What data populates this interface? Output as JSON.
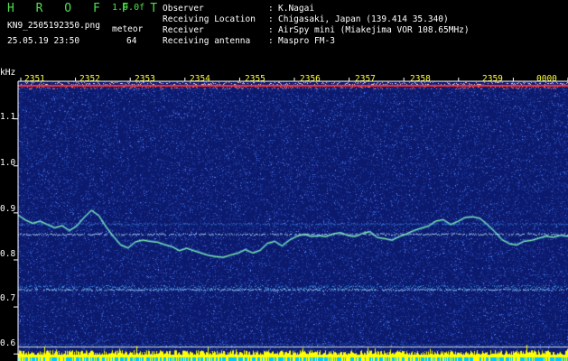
{
  "header": {
    "app_title": "H R O F F T",
    "version": "1.0.0f",
    "filename": "KN9_2505192350.png",
    "datetime": "25.05.19 23:50",
    "meteor_label": "meteor",
    "meteor_count": "64"
  },
  "info": [
    {
      "label": "Observer",
      "value": "K.Nagai"
    },
    {
      "label": "Receiving Location",
      "value": "Chigasaki, Japan (139.414 35.340)"
    },
    {
      "label": "Receiver",
      "value": "AirSpy mini (Miakejima VOR 108.65MHz)"
    },
    {
      "label": "Receiving antenna",
      "value": "Maspro FM-3"
    }
  ],
  "axes": {
    "y_unit": "kHz",
    "y_ticks": [
      {
        "label": "1.1",
        "value": 1.1
      },
      {
        "label": "1.0",
        "value": 1.0
      },
      {
        "label": "0.9",
        "value": 0.9
      },
      {
        "label": "0.8",
        "value": 0.8
      },
      {
        "label": "0.7",
        "value": 0.7
      },
      {
        "label": "0.6",
        "value": 0.6
      }
    ],
    "x_ticks": [
      "2351",
      "2352",
      "2353",
      "2354",
      "2355",
      "2356",
      "2357",
      "2358",
      "2359",
      "0000"
    ]
  },
  "colors": {
    "background": "#000000",
    "spectrogram_bg": "#0c1a6e",
    "noise_dot": "#2f56c8",
    "baseline_band": "#2a9fd8",
    "top_band": "#ff3030",
    "signal_trace": "#8aff8a",
    "axis_text": "#ffff33",
    "header_green": "#4ee04e",
    "bottom_bars": "#ffff00",
    "bottom_base": "#00c8ff"
  },
  "spectrogram": {
    "y_range": [
      0.585,
      1.18
    ],
    "trace_khz": [
      0.895,
      0.885,
      0.878,
      0.882,
      0.875,
      0.868,
      0.873,
      0.862,
      0.872,
      0.89,
      0.905,
      0.895,
      0.87,
      0.85,
      0.832,
      0.825,
      0.838,
      0.842,
      0.84,
      0.838,
      0.832,
      0.828,
      0.82,
      0.825,
      0.82,
      0.815,
      0.81,
      0.807,
      0.805,
      0.81,
      0.815,
      0.822,
      0.815,
      0.82,
      0.835,
      0.84,
      0.83,
      0.842,
      0.85,
      0.855,
      0.85,
      0.852,
      0.85,
      0.855,
      0.858,
      0.852,
      0.85,
      0.856,
      0.86,
      0.848,
      0.845,
      0.842,
      0.85,
      0.855,
      0.862,
      0.868,
      0.872,
      0.882,
      0.885,
      0.875,
      0.882,
      0.89,
      0.892,
      0.888,
      0.875,
      0.86,
      0.843,
      0.835,
      0.832,
      0.84,
      0.842,
      0.846,
      0.85,
      0.848,
      0.852,
      0.85
    ]
  }
}
